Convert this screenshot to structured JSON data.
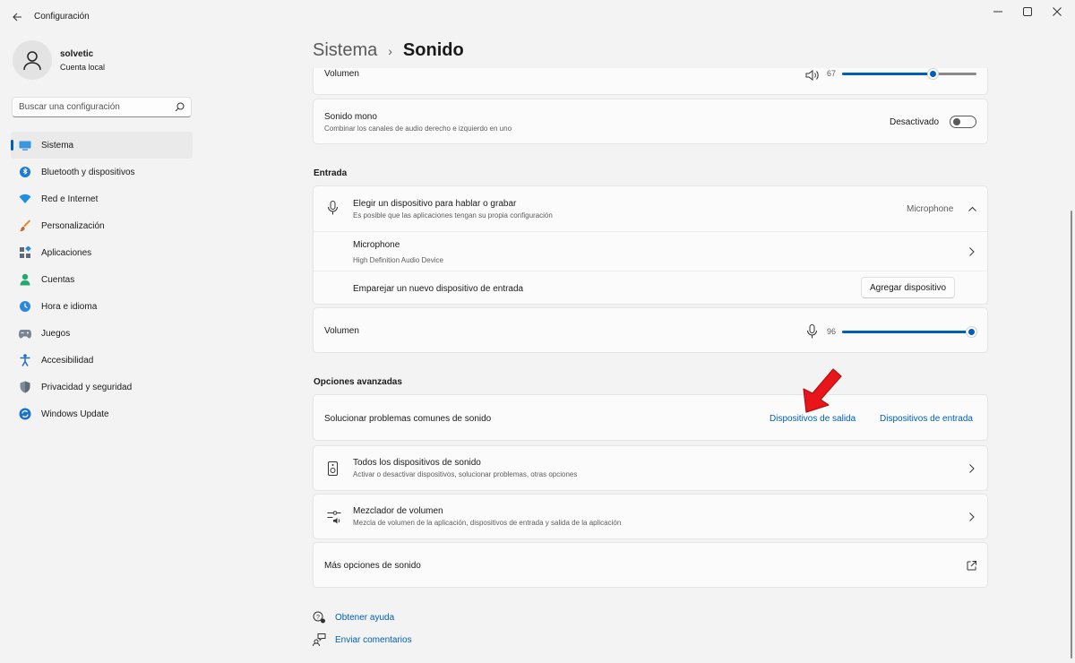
{
  "window": {
    "title": "Configuración"
  },
  "profile": {
    "name": "solvetic",
    "account_type": "Cuenta local"
  },
  "search": {
    "placeholder": "Buscar una configuración"
  },
  "sidebar": {
    "items": [
      {
        "label": "Sistema",
        "icon": "system-icon",
        "active": true
      },
      {
        "label": "Bluetooth y dispositivos",
        "icon": "bluetooth-icon"
      },
      {
        "label": "Red e Internet",
        "icon": "wifi-icon"
      },
      {
        "label": "Personalización",
        "icon": "brush-icon"
      },
      {
        "label": "Aplicaciones",
        "icon": "apps-icon"
      },
      {
        "label": "Cuentas",
        "icon": "person-icon"
      },
      {
        "label": "Hora e idioma",
        "icon": "globe-clock-icon"
      },
      {
        "label": "Juegos",
        "icon": "gamepad-icon"
      },
      {
        "label": "Accesibilidad",
        "icon": "accessibility-icon"
      },
      {
        "label": "Privacidad y seguridad",
        "icon": "shield-icon"
      },
      {
        "label": "Windows Update",
        "icon": "update-icon"
      }
    ]
  },
  "breadcrumb": {
    "parent": "Sistema",
    "separator": "›",
    "current": "Sonido"
  },
  "output": {
    "volume_label": "Volumen",
    "volume_value": "67",
    "volume_fraction": 0.67,
    "mono_title": "Sonido mono",
    "mono_desc": "Combinar los canales de audio derecho e izquierdo en uno",
    "mono_state": "Desactivado"
  },
  "input": {
    "heading": "Entrada",
    "choose_title": "Elegir un dispositivo para hablar o grabar",
    "choose_desc": "Es posible que las aplicaciones tengan su propia configuración",
    "selected_device": "Microphone",
    "device_name": "Microphone",
    "device_desc": "High Definition Audio Device",
    "pair_label": "Emparejar un nuevo dispositivo de entrada",
    "add_button": "Agregar dispositivo",
    "volume_label": "Volumen",
    "volume_value": "96",
    "volume_fraction": 0.96
  },
  "advanced": {
    "heading": "Opciones avanzadas",
    "troubleshoot_label": "Solucionar problemas comunes de sonido",
    "output_link": "Dispositivos de salida",
    "input_link": "Dispositivos de entrada",
    "all_devices_title": "Todos los dispositivos de sonido",
    "all_devices_desc": "Activar o desactivar dispositivos, solucionar problemas, otras opciones",
    "mixer_title": "Mezclador de volumen",
    "mixer_desc": "Mezcla de volumen de la aplicación, dispositivos de entrada y salida de la aplicación",
    "more_options": "Más opciones de sonido"
  },
  "footer": {
    "help": "Obtener ayuda",
    "feedback": "Enviar comentarios"
  },
  "colors": {
    "accent": "#005fb8",
    "annotation_arrow": "#e8161b"
  }
}
